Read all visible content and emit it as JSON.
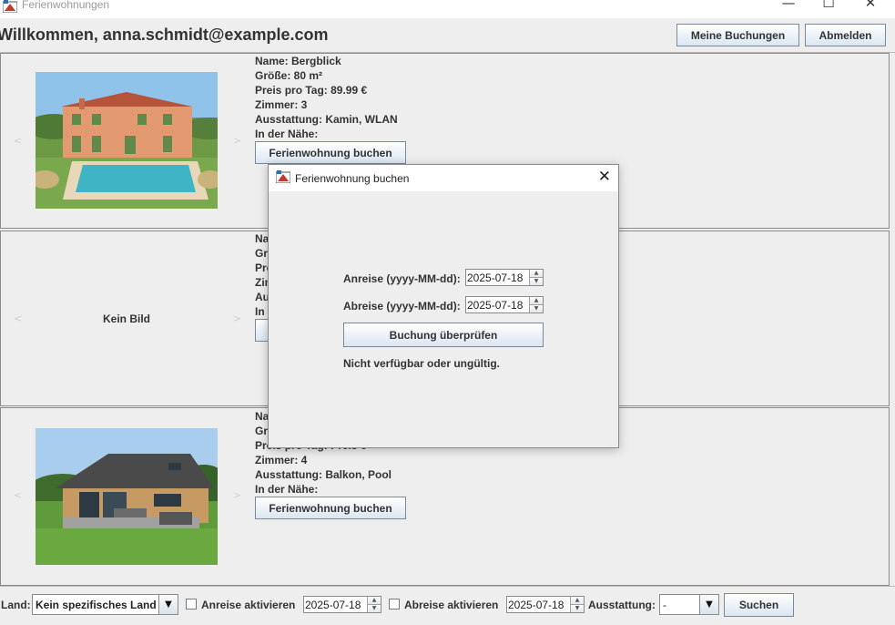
{
  "window": {
    "title": "Ferienwohnungen",
    "minimize": "—",
    "maximize": "☐",
    "close": "✕"
  },
  "header": {
    "welcome": "Willkommen, anna.schmidt@example.com",
    "my_bookings": "Meine Buchungen",
    "logout": "Abmelden"
  },
  "listings": [
    {
      "name": "Name: Bergblick",
      "size": "Größe: 80 m²",
      "price": "Preis pro Tag: 89.99 €",
      "rooms": "Zimmer: 3",
      "amenities": "Ausstattung: Kamin, WLAN",
      "nearby": "In der Nähe:",
      "book": "Ferienwohnung buchen",
      "prev": "<",
      "next": ">"
    },
    {
      "name": "Na",
      "size": "Grö",
      "price": "Pre",
      "rooms": "Zim",
      "amenities": "Au",
      "nearby": "In c",
      "image_text": "Kein Bild",
      "prev": "<",
      "next": ">"
    },
    {
      "name": "Na",
      "size": "Grö",
      "price": "Preis pro Tag: Preis €",
      "rooms": "Zimmer: 4",
      "amenities": "Ausstattung: Balkon, Pool",
      "nearby": "In der Nähe:",
      "book": "Ferienwohnung buchen",
      "prev": "<",
      "next": ">"
    }
  ],
  "dialog": {
    "title": "Ferienwohnung buchen",
    "close": "✕",
    "arrival_label": "Anreise (yyyy-MM-dd):",
    "arrival_value": "2025-07-18",
    "departure_label": "Abreise (yyyy-MM-dd):",
    "departure_value": "2025-07-18",
    "check_button": "Buchung überprüfen",
    "status": "Nicht verfügbar oder ungültig."
  },
  "filter": {
    "land_label": "Land:",
    "land_value": "Kein spezifisches Land",
    "arrival_checkbox": "Anreise aktivieren",
    "arrival_date": "2025-07-18",
    "departure_checkbox": "Abreise aktivieren",
    "departure_date": "2025-07-18",
    "amenities_label": "Ausstattung:",
    "amenities_value": "-",
    "search_button": "Suchen"
  },
  "icons": {
    "spinner_up": "▲",
    "spinner_down": "▼",
    "dropdown": "▼"
  }
}
